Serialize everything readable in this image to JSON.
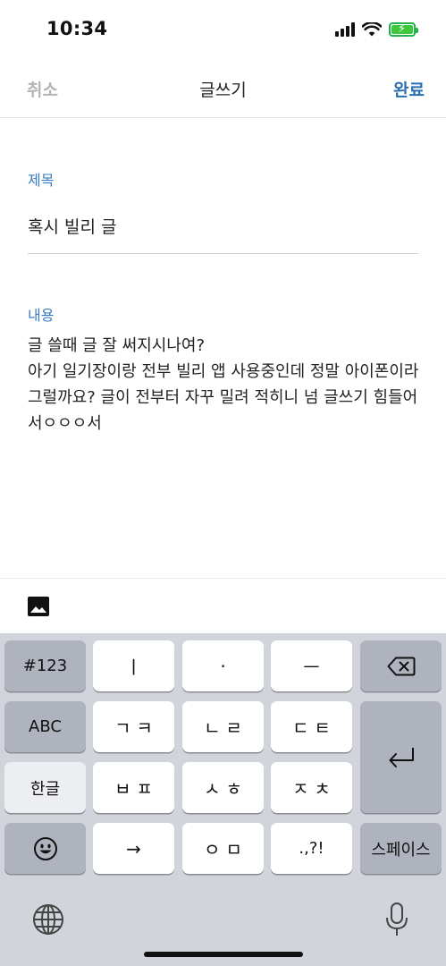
{
  "status_bar": {
    "time": "10:34"
  },
  "nav": {
    "cancel_label": "취소",
    "title": "글쓰기",
    "done_label": "완료"
  },
  "form": {
    "title_label": "제목",
    "title_value": "혹시 빌리 글",
    "content_label": "내용",
    "content_value": "글 쓸때 글 잘 써지시나여?\n아기 일기장이랑 전부 빌리 앱 사용중인데 정말 아이폰이라 그럴까요? 글이 전부터 자꾸 밀려 적히니 넘 글쓰기 힘들어서ㅇㅇㅇ서"
  },
  "attachment": {
    "icon": "image-icon"
  },
  "keyboard": {
    "key_numbers": "#123",
    "key_vowel_1": "ㅣ",
    "key_vowel_2": "·",
    "key_vowel_3": "ㅡ",
    "key_abc": "ABC",
    "key_gk": "ㄱㅋ",
    "key_nr": "ㄴㄹ",
    "key_dt": "ㄷㅌ",
    "key_hangul": "한글",
    "key_bp": "ㅂㅍ",
    "key_sh": "ㅅㅎ",
    "key_jc": "ㅈㅊ",
    "key_arrow": "→",
    "key_om": "ㅇㅁ",
    "key_punct": ".,?!",
    "key_space": "스페이스",
    "icons": [
      "backspace-icon",
      "return-icon",
      "emoji-icon",
      "globe-icon",
      "mic-icon"
    ]
  }
}
